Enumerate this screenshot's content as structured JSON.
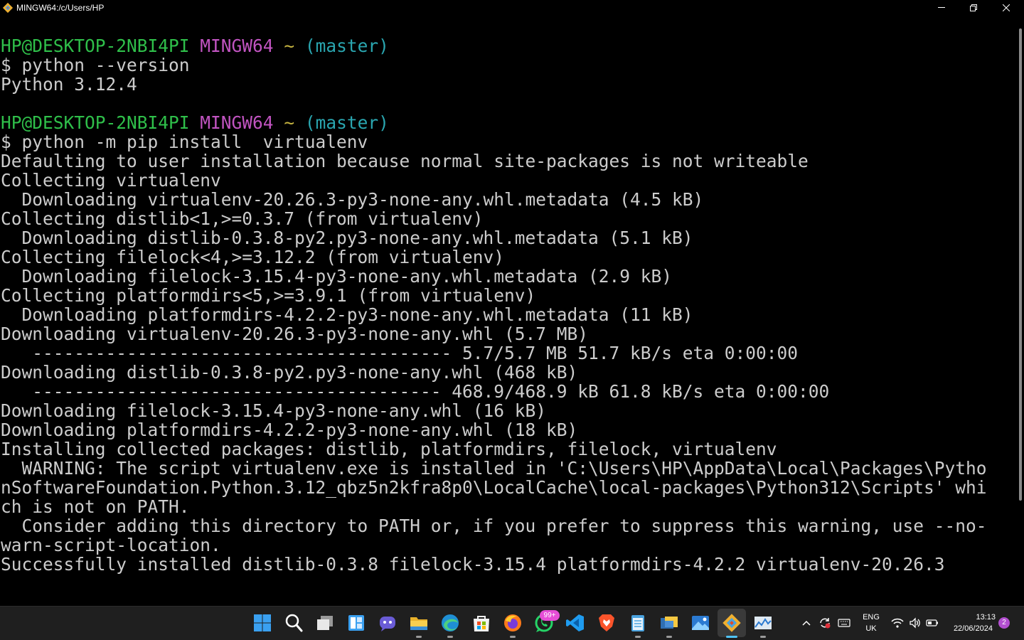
{
  "window": {
    "title": "MINGW64:/c/Users/HP",
    "minimize_icon": "minimize-icon",
    "maximize_icon": "restore-icon",
    "close_icon": "close-icon"
  },
  "terminal": {
    "colors": {
      "user_host": "#2fbf4a",
      "system": "#c154c1",
      "path": "#c7b541",
      "branch": "#2aa6b0",
      "output": "#cccccc"
    },
    "prompt1": {
      "user_host": "HP@DESKTOP-2NBI4PI",
      "system": "MINGW64",
      "path": "~",
      "branch": "(master)"
    },
    "command1": "$ python --version",
    "output1": [
      "Python 3.12.4"
    ],
    "prompt2": {
      "user_host": "HP@DESKTOP-2NBI4PI",
      "system": "MINGW64",
      "path": "~",
      "branch": "(master)"
    },
    "command2": "$ python -m pip install  virtualenv",
    "output2": [
      "Defaulting to user installation because normal site-packages is not writeable",
      "Collecting virtualenv",
      "  Downloading virtualenv-20.26.3-py3-none-any.whl.metadata (4.5 kB)",
      "Collecting distlib<1,>=0.3.7 (from virtualenv)",
      "  Downloading distlib-0.3.8-py2.py3-none-any.whl.metadata (5.1 kB)",
      "Collecting filelock<4,>=3.12.2 (from virtualenv)",
      "  Downloading filelock-3.15.4-py3-none-any.whl.metadata (2.9 kB)",
      "Collecting platformdirs<5,>=3.9.1 (from virtualenv)",
      "  Downloading platformdirs-4.2.2-py3-none-any.whl.metadata (11 kB)",
      "Downloading virtualenv-20.26.3-py3-none-any.whl (5.7 MB)",
      "   ---------------------------------------- 5.7/5.7 MB 51.7 kB/s eta 0:00:00",
      "Downloading distlib-0.3.8-py2.py3-none-any.whl (468 kB)",
      "   --------------------------------------- 468.9/468.9 kB 61.8 kB/s eta 0:00:00",
      "Downloading filelock-3.15.4-py3-none-any.whl (16 kB)",
      "Downloading platformdirs-4.2.2-py3-none-any.whl (18 kB)",
      "Installing collected packages: distlib, platformdirs, filelock, virtualenv",
      "  WARNING: The script virtualenv.exe is installed in 'C:\\Users\\HP\\AppData\\Local\\Packages\\Pytho",
      "nSoftwareFoundation.Python.3.12_qbz5n2kfra8p0\\LocalCache\\local-packages\\Python312\\Scripts' whi",
      "ch is not on PATH.",
      "  Consider adding this directory to PATH or, if you prefer to suppress this warning, use --no-",
      "warn-script-location.",
      "Successfully installed distlib-0.3.8 filelock-3.15.4 platformdirs-4.2.2 virtualenv-20.26.3"
    ]
  },
  "taskbar": {
    "apps": [
      {
        "name": "start-button",
        "icon": "windows-icon"
      },
      {
        "name": "search-button",
        "icon": "search-icon"
      },
      {
        "name": "task-view-button",
        "icon": "task-view-icon"
      },
      {
        "name": "widgets-button",
        "icon": "widgets-icon"
      },
      {
        "name": "chat-button",
        "icon": "chat-icon"
      },
      {
        "name": "file-explorer-button",
        "icon": "folder-icon"
      },
      {
        "name": "edge-button",
        "icon": "edge-icon"
      },
      {
        "name": "store-button",
        "icon": "store-icon"
      },
      {
        "name": "firefox-button",
        "icon": "firefox-icon"
      },
      {
        "name": "whatsapp-button",
        "icon": "whatsapp-icon"
      },
      {
        "name": "vscode-button",
        "icon": "vscode-icon"
      },
      {
        "name": "brave-button",
        "icon": "brave-icon"
      },
      {
        "name": "notepad-button",
        "icon": "notepad-icon"
      },
      {
        "name": "python-button",
        "icon": "python-icon"
      },
      {
        "name": "photos-button",
        "icon": "photos-icon"
      },
      {
        "name": "git-bash-button",
        "icon": "git-icon"
      },
      {
        "name": "task-manager-button",
        "icon": "monitor-chart-icon"
      }
    ],
    "whatsapp_badge": "99+",
    "tray": {
      "chevron_icon": "chevron-up-icon",
      "sync_icon": "sync-icon",
      "keyboard_icon": "keyboard-icon",
      "lang_primary": "ENG",
      "lang_secondary": "UK",
      "wifi_icon": "wifi-icon",
      "volume_icon": "volume-icon",
      "battery_icon": "battery-icon",
      "time": "13:13",
      "date": "22/06/2024",
      "notification_count": "2"
    }
  }
}
